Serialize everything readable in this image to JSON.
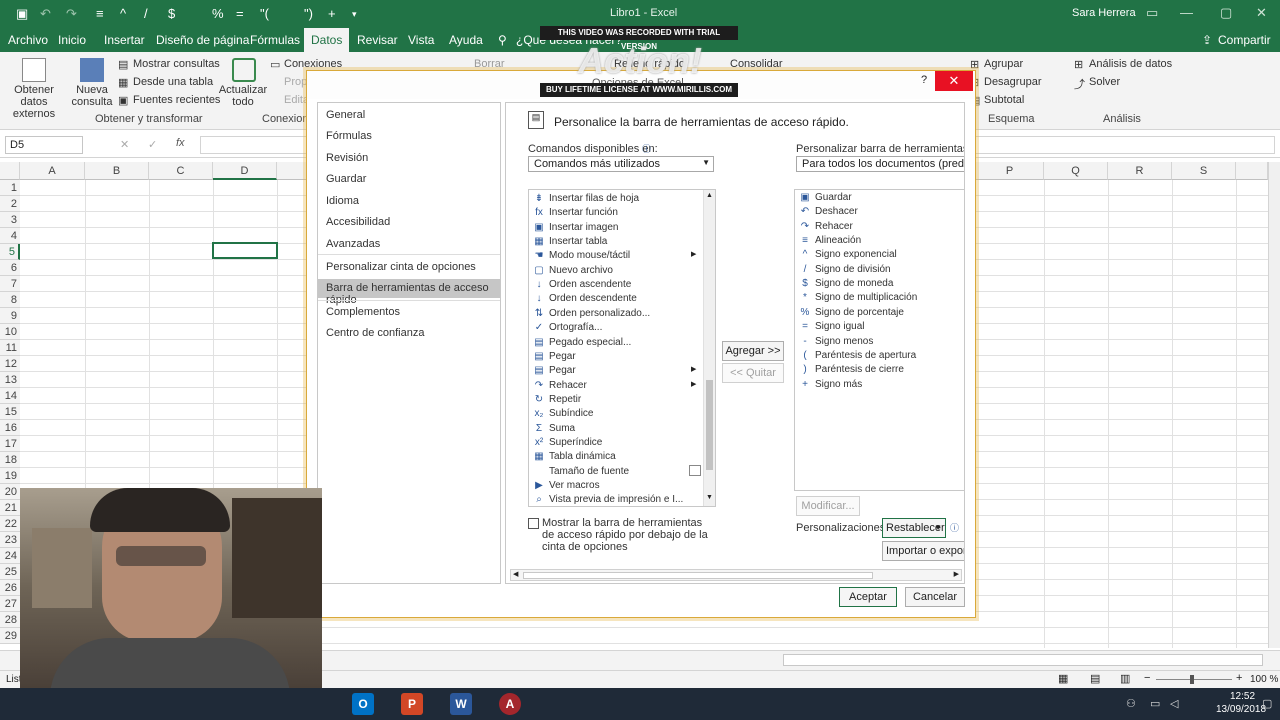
{
  "titlebar": {
    "doc_title": "Libro1 - Excel",
    "user": "Sara Herrera",
    "qat_symbols": [
      "$",
      "%",
      "=",
      "\"(",
      "\")",
      "+"
    ]
  },
  "menu": {
    "tabs": [
      "Archivo",
      "Inicio",
      "Insertar",
      "Diseño de página",
      "Fórmulas",
      "Datos",
      "Revisar",
      "Vista",
      "Ayuda"
    ],
    "tell_me": "¿Qué desea hacer?",
    "share": "Compartir"
  },
  "ribbon": {
    "get_external": "Obtener datos externos",
    "new_query": "Nueva consulta",
    "show_queries": "Mostrar consultas",
    "from_table": "Desde una tabla",
    "recent_sources": "Fuentes recientes",
    "refresh_all": "Actualizar todo",
    "connections": "Conexiones",
    "props": "Prop",
    "edit": "Edita",
    "clear": "Borrar",
    "flash_fill": "Relleno rápido",
    "consolidate": "Consolidar",
    "group": "Agrupar",
    "ungroup": "Desagrupar",
    "subtotal": "Subtotal",
    "data_analysis": "Análisis de datos",
    "solver": "Solver",
    "group_get_transform": "Obtener y transformar",
    "group_connections": "Conexion",
    "group_outline": "Esquema",
    "group_analysis": "Análisis"
  },
  "formula": {
    "namebox": "D5",
    "fx": "fx"
  },
  "grid": {
    "columns": [
      "A",
      "B",
      "C",
      "D",
      "P",
      "Q",
      "R",
      "S"
    ],
    "rows": [
      "1",
      "2",
      "3",
      "4",
      "5",
      "6",
      "7",
      "8",
      "9",
      "10",
      "11",
      "12",
      "13",
      "14",
      "15",
      "16",
      "17",
      "18",
      "19",
      "20",
      "21",
      "22",
      "23",
      "24",
      "25",
      "26",
      "27",
      "28",
      "29"
    ]
  },
  "status": {
    "ready": "List",
    "zoom": "100 %"
  },
  "taskbar": {
    "time": "12:52",
    "date": "13/09/2018"
  },
  "watermark": {
    "top": "THIS VIDEO WAS RECORDED WITH TRIAL VERSION",
    "logo": "Action!",
    "bottom": "BUY LIFETIME LICENSE AT WWW.MIRILLIS.COM",
    "partial_title": "Opciones de Excel"
  },
  "dialog": {
    "help": "?",
    "close": "✕",
    "nav": [
      "General",
      "Fórmulas",
      "Revisión",
      "Guardar",
      "Idioma",
      "Accesibilidad",
      "Avanzadas",
      "Personalizar cinta de opciones",
      "Barra de herramientas de acceso rápido",
      "Complementos",
      "Centro de confianza"
    ],
    "heading": "Personalice la barra de herramientas de acceso rápido.",
    "commands_label": "Comandos disponibles en:",
    "commands_value": "Comandos más utilizados",
    "customize_label": "Personalizar barra de herramientas de ac",
    "customize_value": "Para todos los documentos (predeterm",
    "left_list": [
      {
        "icon": "⇟",
        "label": "Insertar filas de hoja"
      },
      {
        "icon": "fx",
        "label": "Insertar función"
      },
      {
        "icon": "▣",
        "label": "Insertar imagen"
      },
      {
        "icon": "▦",
        "label": "Insertar tabla"
      },
      {
        "icon": "☚",
        "label": "Modo mouse/táctil"
      },
      {
        "icon": "▢",
        "label": "Nuevo archivo"
      },
      {
        "icon": "↓",
        "label": "Orden ascendente"
      },
      {
        "icon": "↓",
        "label": "Orden descendente"
      },
      {
        "icon": "⇅",
        "label": "Orden personalizado..."
      },
      {
        "icon": "✓",
        "label": "Ortografía..."
      },
      {
        "icon": "▤",
        "label": "Pegado especial..."
      },
      {
        "icon": "▤",
        "label": "Pegar"
      },
      {
        "icon": "▤",
        "label": "Pegar"
      },
      {
        "icon": "↷",
        "label": "Rehacer"
      },
      {
        "icon": "↻",
        "label": "Repetir"
      },
      {
        "icon": "x₂",
        "label": "Subíndice"
      },
      {
        "icon": "Σ",
        "label": "Suma"
      },
      {
        "icon": "x²",
        "label": "Superíndice"
      },
      {
        "icon": "▦",
        "label": "Tabla dinámica"
      },
      {
        "icon": "",
        "label": "Tamaño de fuente"
      },
      {
        "icon": "▶",
        "label": "Ver macros"
      },
      {
        "icon": "⌕",
        "label": "Vista previa de impresión e I..."
      }
    ],
    "right_list": [
      {
        "icon": "▣",
        "label": "Guardar"
      },
      {
        "icon": "↶",
        "label": "Deshacer"
      },
      {
        "icon": "↷",
        "label": "Rehacer"
      },
      {
        "icon": "≡",
        "label": "Alineación"
      },
      {
        "icon": "^",
        "label": "Signo exponencial"
      },
      {
        "icon": "/",
        "label": "Signo de división"
      },
      {
        "icon": "$",
        "label": "Signo de moneda"
      },
      {
        "icon": "*",
        "label": "Signo de multiplicación"
      },
      {
        "icon": "%",
        "label": "Signo de porcentaje"
      },
      {
        "icon": "=",
        "label": "Signo igual"
      },
      {
        "icon": "-",
        "label": "Signo menos"
      },
      {
        "icon": "(",
        "label": "Paréntesis de apertura"
      },
      {
        "icon": ")",
        "label": "Paréntesis de cierre"
      },
      {
        "icon": "+",
        "label": "Signo más"
      }
    ],
    "add": "Agregar >>",
    "remove": "<< Quitar",
    "modify": "Modificar...",
    "show_below": "Mostrar la barra de herramientas de acceso rápido por debajo de la cinta de opciones",
    "customizations": "Personalizaciones:",
    "reset": "Restablecer",
    "import_export": "Importar o exportar",
    "ok": "Aceptar",
    "cancel": "Cancelar"
  }
}
